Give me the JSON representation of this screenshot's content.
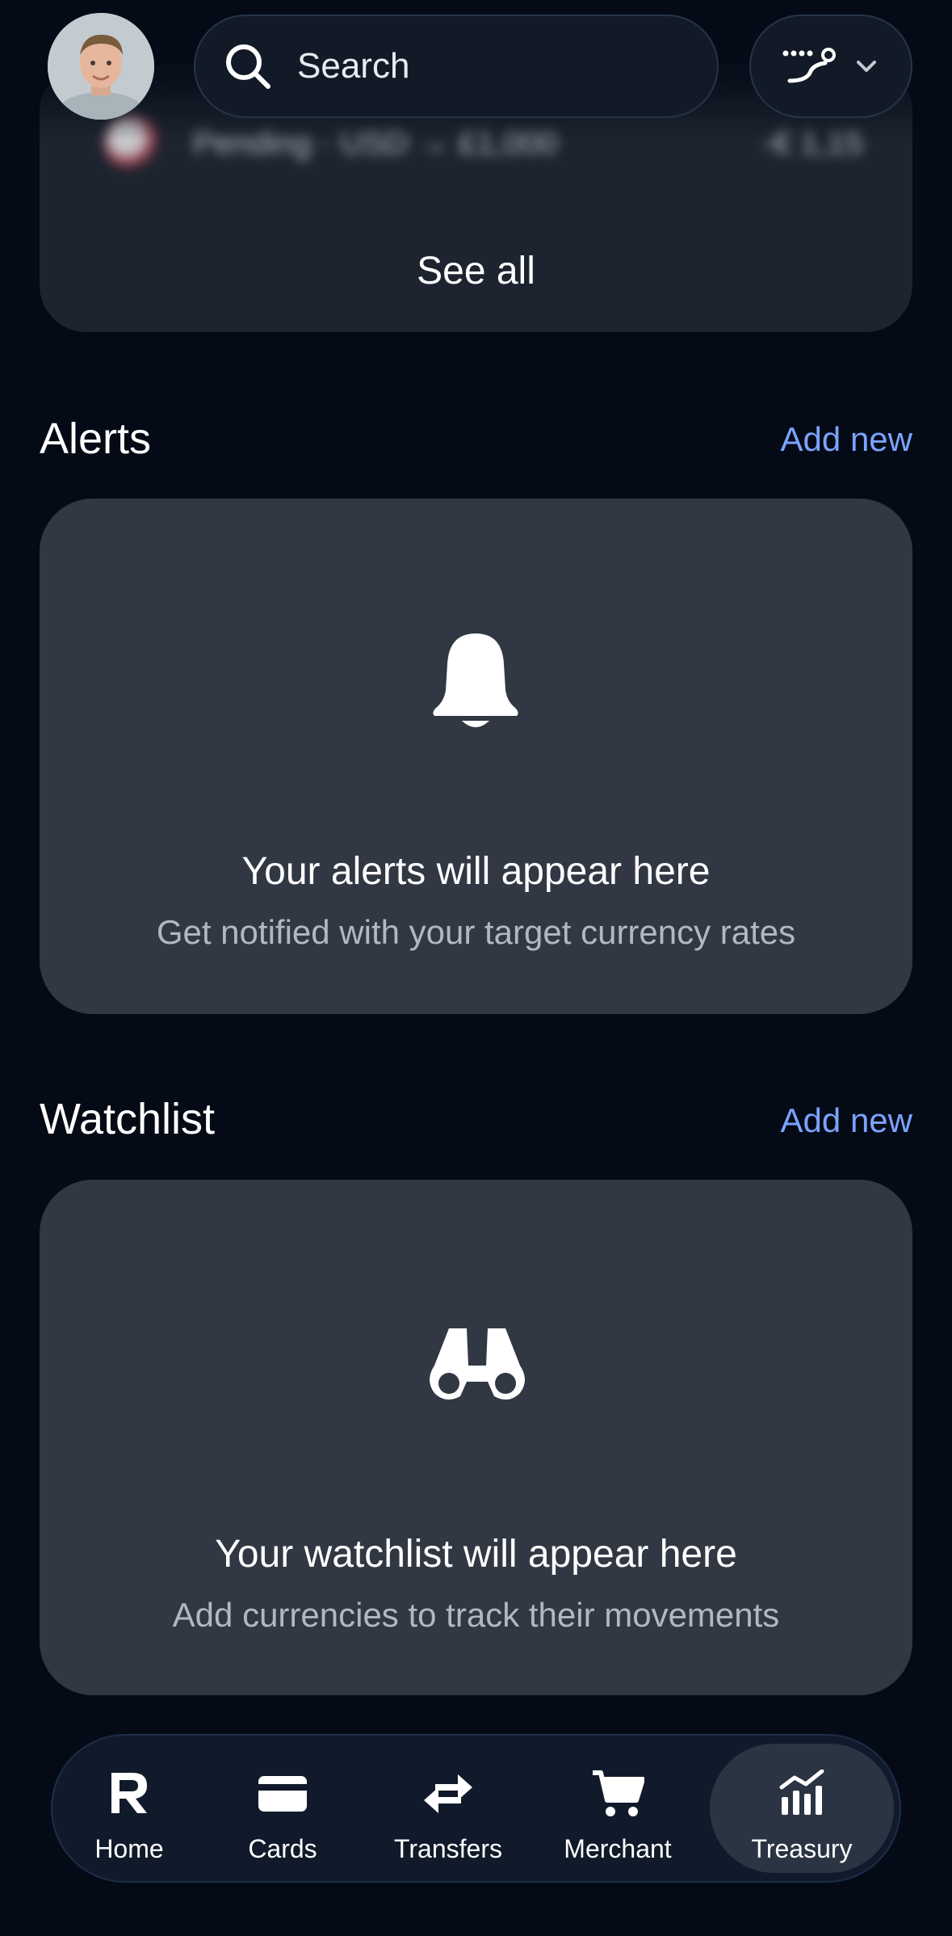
{
  "header": {
    "search_placeholder": "Search"
  },
  "top_card": {
    "see_all_label": "See all",
    "blurred_text": "Pending · USD → £1,000",
    "blurred_amount": "-€ 1,15"
  },
  "alerts": {
    "title": "Alerts",
    "add_new_label": "Add new",
    "empty_title": "Your alerts will appear here",
    "empty_subtitle": "Get notified with your target currency rates",
    "icon": "bell-icon"
  },
  "watchlist": {
    "title": "Watchlist",
    "add_new_label": "Add new",
    "empty_title": "Your watchlist will appear here",
    "empty_subtitle": "Add currencies to track their movements",
    "icon": "binoculars-icon"
  },
  "nav": {
    "items": [
      {
        "label": "Home",
        "icon": "revolut-r-icon"
      },
      {
        "label": "Cards",
        "icon": "card-icon"
      },
      {
        "label": "Transfers",
        "icon": "transfer-arrows-icon"
      },
      {
        "label": "Merchant",
        "icon": "cart-icon"
      },
      {
        "label": "Treasury",
        "icon": "chart-icon",
        "active": true
      }
    ]
  },
  "colors": {
    "background": "#050b16",
    "card": "#313844",
    "accent_link": "#7ba3ff"
  }
}
